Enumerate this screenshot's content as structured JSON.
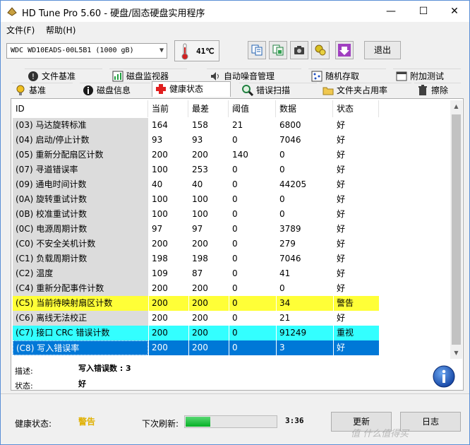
{
  "window": {
    "title": "HD Tune Pro 5.60 - 硬盘/固态硬盘实用程序",
    "controls": {
      "minimize": "—",
      "maximize": "☐",
      "close": "✕"
    }
  },
  "menu": [
    "文件(F)",
    "帮助(H)"
  ],
  "toolbar": {
    "drive": "WDC WD10EADS-00L5B1 (1000 gB)",
    "temperature": "41℃",
    "exit_label": "退出",
    "buttons": [
      "copy-text-icon",
      "copy-image-icon",
      "camera-icon",
      "options-icon",
      "save-download-icon"
    ]
  },
  "tabs_top": [
    {
      "label": "文件基准",
      "icon": "file-benchmark-icon"
    },
    {
      "label": "磁盘监视器",
      "icon": "disk-monitor-icon"
    },
    {
      "label": "自动噪音管理",
      "icon": "speaker-icon"
    },
    {
      "label": "随机存取",
      "icon": "random-access-icon"
    },
    {
      "label": "附加测试",
      "icon": "extra-tests-icon"
    }
  ],
  "tabs_bottom": [
    {
      "label": "基准",
      "icon": "lightbulb-icon"
    },
    {
      "label": "磁盘信息",
      "icon": "info-icon"
    },
    {
      "label": "健康状态",
      "icon": "health-cross-icon"
    },
    {
      "label": "错误扫描",
      "icon": "magnifier-icon"
    },
    {
      "label": "文件夹占用率",
      "icon": "folder-icon"
    },
    {
      "label": "擦除",
      "icon": "trash-icon"
    }
  ],
  "active_tab": "健康状态",
  "table": {
    "headers": [
      "ID",
      "当前",
      "最差",
      "阈值",
      "数据",
      "状态"
    ],
    "rows": [
      {
        "id": "(03) 马达旋转标准",
        "current": "164",
        "worst": "158",
        "threshold": "21",
        "data": "6800",
        "status": "好",
        "style": ""
      },
      {
        "id": "(04) 启动/停止计数",
        "current": "93",
        "worst": "93",
        "threshold": "0",
        "data": "7046",
        "status": "好",
        "style": ""
      },
      {
        "id": "(05) 重新分配扇区计数",
        "current": "200",
        "worst": "200",
        "threshold": "140",
        "data": "0",
        "status": "好",
        "style": ""
      },
      {
        "id": "(07) 寻道错误率",
        "current": "100",
        "worst": "253",
        "threshold": "0",
        "data": "0",
        "status": "好",
        "style": ""
      },
      {
        "id": "(09) 通电时间计数",
        "current": "40",
        "worst": "40",
        "threshold": "0",
        "data": "44205",
        "status": "好",
        "style": ""
      },
      {
        "id": "(0A) 旋转重试计数",
        "current": "100",
        "worst": "100",
        "threshold": "0",
        "data": "0",
        "status": "好",
        "style": ""
      },
      {
        "id": "(0B) 校准重试计数",
        "current": "100",
        "worst": "100",
        "threshold": "0",
        "data": "0",
        "status": "好",
        "style": ""
      },
      {
        "id": "(0C) 电源周期计数",
        "current": "97",
        "worst": "97",
        "threshold": "0",
        "data": "3789",
        "status": "好",
        "style": ""
      },
      {
        "id": "(C0) 不安全关机计数",
        "current": "200",
        "worst": "200",
        "threshold": "0",
        "data": "279",
        "status": "好",
        "style": ""
      },
      {
        "id": "(C1) 负载周期计数",
        "current": "198",
        "worst": "198",
        "threshold": "0",
        "data": "7046",
        "status": "好",
        "style": ""
      },
      {
        "id": "(C2) 温度",
        "current": "109",
        "worst": "87",
        "threshold": "0",
        "data": "41",
        "status": "好",
        "style": ""
      },
      {
        "id": "(C4) 重新分配事件计数",
        "current": "200",
        "worst": "200",
        "threshold": "0",
        "data": "0",
        "status": "好",
        "style": ""
      },
      {
        "id": "(C5) 当前待映射扇区计数",
        "current": "200",
        "worst": "200",
        "threshold": "0",
        "data": "34",
        "status": "警告",
        "style": "warn"
      },
      {
        "id": "(C6) 离线无法校正",
        "current": "200",
        "worst": "200",
        "threshold": "0",
        "data": "21",
        "status": "好",
        "style": ""
      },
      {
        "id": "(C7) 接口 CRC 错误计数",
        "current": "200",
        "worst": "200",
        "threshold": "0",
        "data": "91249",
        "status": "重视",
        "style": "cyan"
      },
      {
        "id": "(C8) 写入错误率",
        "current": "200",
        "worst": "200",
        "threshold": "0",
        "data": "3",
        "status": "好",
        "style": "sel"
      }
    ]
  },
  "details": {
    "desc_label": "描述:",
    "desc_value": "写入错误数 : 3",
    "status_label": "状态:",
    "status_value": "好"
  },
  "footer": {
    "health_label": "健康状态:",
    "health_value": "警告",
    "refresh_label": "下次刷新:",
    "progress": 0.27,
    "time": "3:36",
    "update_label": "更新",
    "log_label": "日志"
  },
  "watermark": "值 什么值得买",
  "colors": {
    "warn": "#ffff37",
    "cyan": "#33ffff",
    "selected": "#0078d7",
    "progress": "#06b025"
  }
}
